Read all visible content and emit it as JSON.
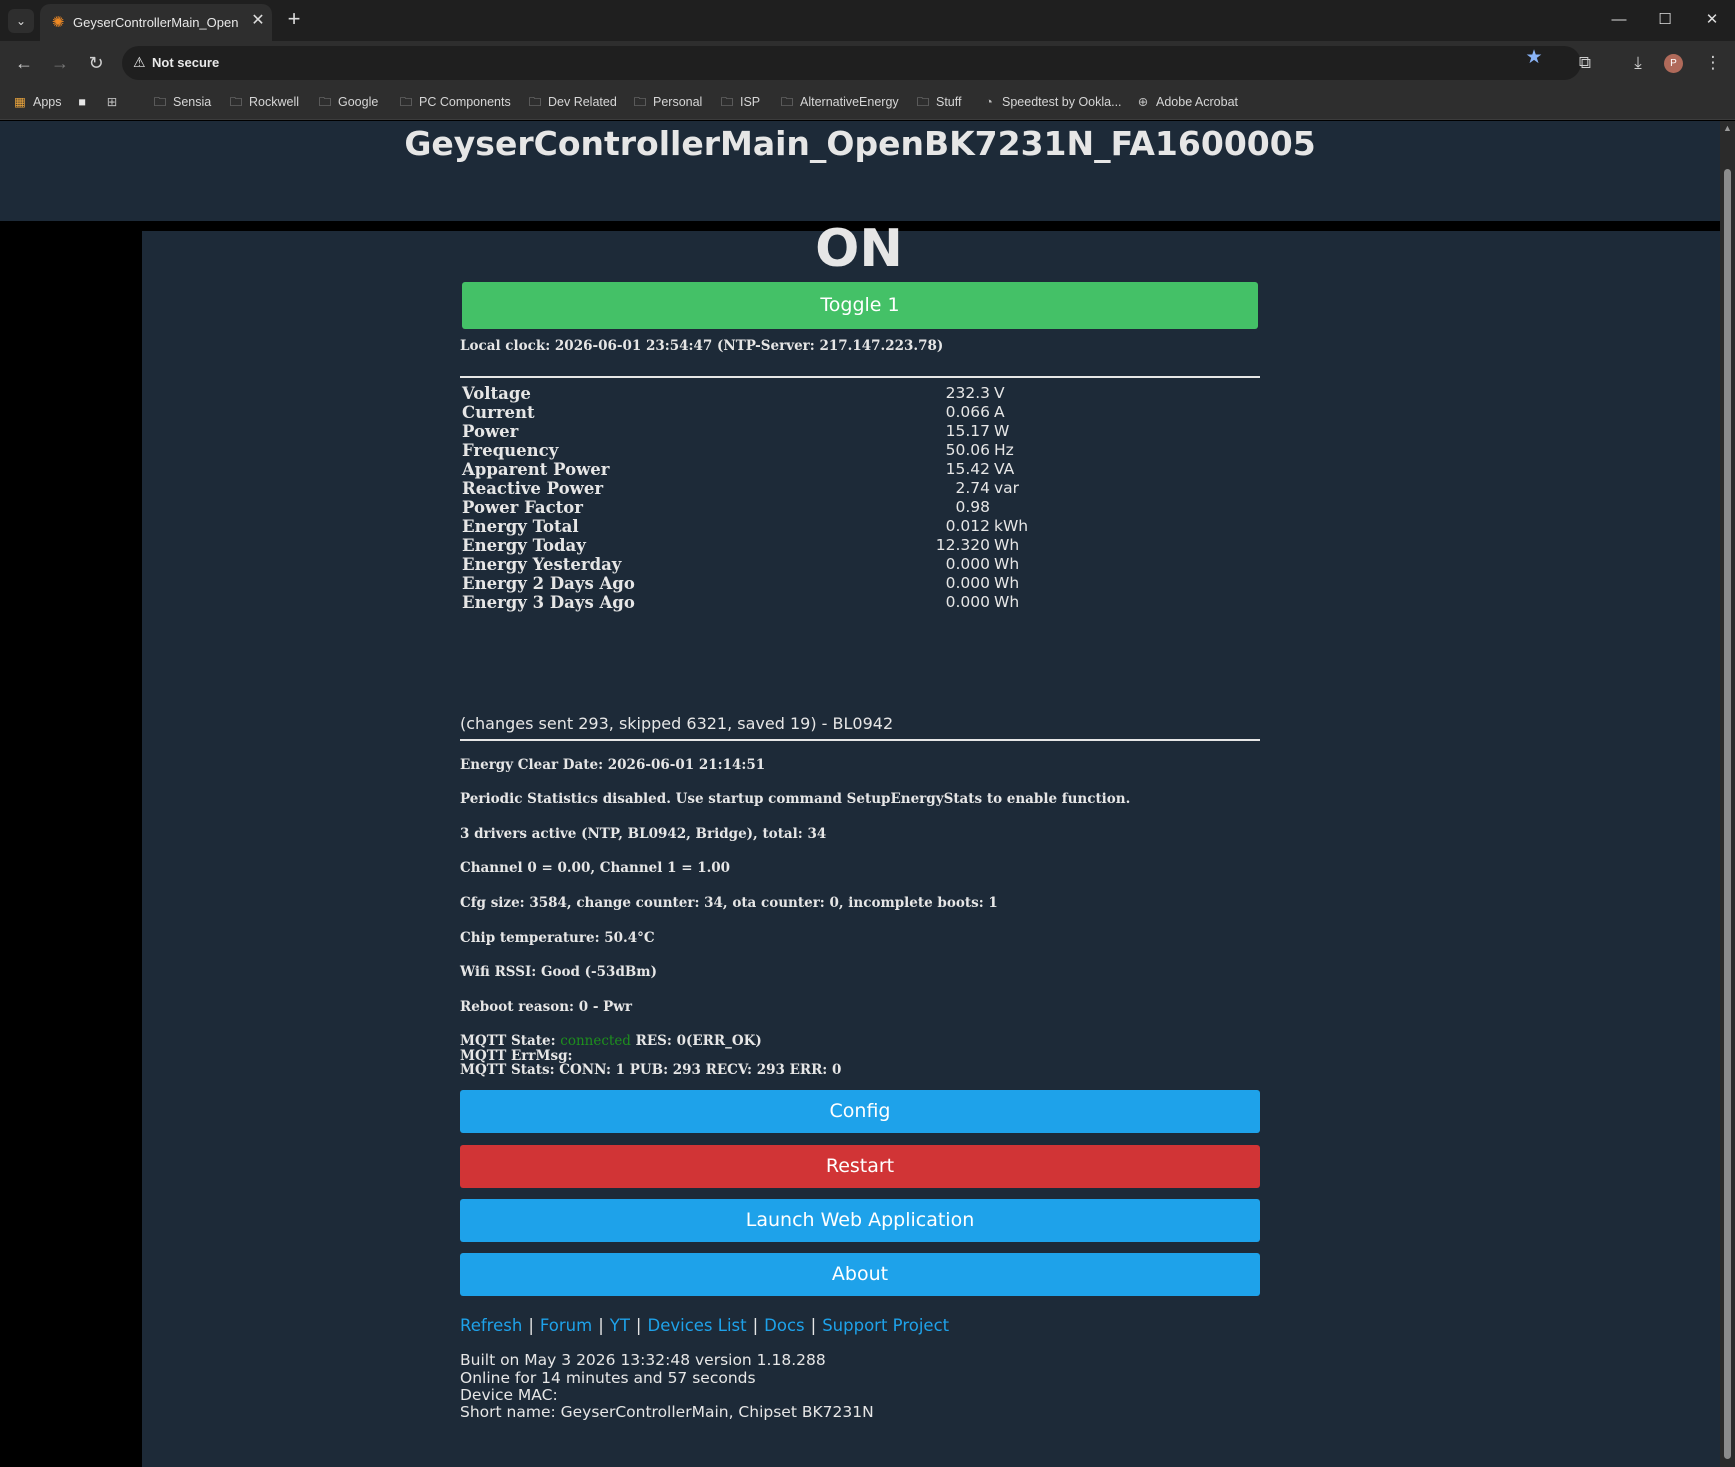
{
  "browser": {
    "tab_title": "GeyserControllerMain_OpenBK7231N_FA1600005",
    "address_security": "Not secure",
    "bookmarks": [
      "Apps",
      "Sensia",
      "Rockwell",
      "Google",
      "PC Components",
      "Dev Related",
      "Personal",
      "ISP",
      "AlternativeEnergy",
      "Stuff",
      "Speedtest by Ookla...",
      "Adobe Acrobat"
    ],
    "avatar_letter": "P"
  },
  "page": {
    "title": "GeyserControllerMain_OpenBK7231N_FA1600005",
    "state": "ON",
    "toggle_label": "Toggle 1",
    "local_clock": "Local clock: 2026-06-01 23:54:47 (NTP-Server: 217.147.223.78)",
    "stats": [
      {
        "name": "Voltage",
        "value": "232.3",
        "unit": "V"
      },
      {
        "name": "Current",
        "value": "0.066",
        "unit": "A"
      },
      {
        "name": "Power",
        "value": "15.17",
        "unit": "W"
      },
      {
        "name": "Frequency",
        "value": "50.06",
        "unit": "Hz"
      },
      {
        "name": "Apparent Power",
        "value": "15.42",
        "unit": "VA"
      },
      {
        "name": "Reactive Power",
        "value": "2.74",
        "unit": "var"
      },
      {
        "name": "Power Factor",
        "value": "0.98",
        "unit": ""
      },
      {
        "name": "Energy Total",
        "value": "0.012",
        "unit": "kWh"
      },
      {
        "name": "Energy Today",
        "value": "12.320",
        "unit": "Wh"
      },
      {
        "name": "Energy Yesterday",
        "value": "0.000",
        "unit": "Wh"
      },
      {
        "name": "Energy 2 Days Ago",
        "value": "0.000",
        "unit": "Wh"
      },
      {
        "name": "Energy 3 Days Ago",
        "value": "0.000",
        "unit": "Wh"
      }
    ],
    "changes_note": "(changes sent 293, skipped 6321, saved 19) - BL0942",
    "energy_clear_date": "Energy Clear Date: 2026-06-01 21:14:51",
    "periodic_stats": "Periodic Statistics disabled. Use startup command SetupEnergyStats to enable function.",
    "drivers": "3 drivers active (NTP, BL0942, Bridge), total: 34",
    "channels": "Channel 0 = 0.00, Channel 1 = 1.00",
    "cfg": "Cfg size: 3584, change counter: 34, ota counter: 0, incomplete boots: 1",
    "chip_temp": "Chip temperature: 50.4°C",
    "wifi": "Wifi RSSI: Good (-53dBm)",
    "reboot": "Reboot reason: 0 - Pwr",
    "mqtt_state_label": "MQTT State:",
    "mqtt_state_value": "connected",
    "mqtt_res": "RES: 0(ERR_OK)",
    "mqtt_errmsg": "MQTT ErrMsg:",
    "mqtt_stats": "MQTT Stats: CONN: 1 PUB: 293 RECV: 293 ERR: 0",
    "buttons": {
      "config": "Config",
      "restart": "Restart",
      "launch": "Launch Web Application",
      "about": "About"
    },
    "links": [
      "Refresh",
      "Forum",
      "YT",
      "Devices List",
      "Docs",
      "Support Project"
    ],
    "link_separator": "|",
    "footer": [
      "Built on May 3 2026 13:32:48 version 1.18.288",
      "Online for 14 minutes and 57 seconds",
      "Device MAC:",
      "Short name: GeyserControllerMain, Chipset BK7231N"
    ]
  },
  "colors": {
    "page_bg": "#1d2a38",
    "toggle_green": "#44c167",
    "button_blue": "#1ea2ea",
    "button_red": "#d13436",
    "mqtt_connected": "#1e8e1e"
  }
}
